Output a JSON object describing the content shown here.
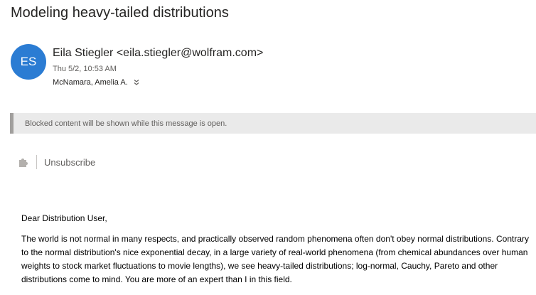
{
  "message": {
    "subject": "Modeling heavy-tailed distributions",
    "avatar_initials": "ES",
    "sender": "Eila Stiegler <eila.stiegler@wolfram.com>",
    "date": "Thu 5/2, 10:53 AM",
    "recipients": "McNamara, Amelia A."
  },
  "banner": {
    "text": "Blocked content will be shown while this message is open."
  },
  "actions": {
    "unsubscribe_label": "Unsubscribe"
  },
  "body": {
    "greeting": "Dear Distribution User,",
    "paragraph1": "The world is not normal in many respects, and practically observed random phenomena often don't obey normal distributions. Contrary to the normal distribution's nice exponential decay, in a large variety of real-world phenomena (from chemical abundances over human weights to stock market fluctuations to movie lengths), we see heavy-tailed distributions; log-normal, Cauchy, Pareto and other distributions come to mind. You are more of an expert than I in this field."
  },
  "colors": {
    "avatar_bg": "#2b7cd3",
    "banner_bg": "#eaeaea",
    "banner_border": "#a19f9d"
  },
  "icons": {
    "expand": "chevron-double-down-icon",
    "add_in": "puzzle-piece-icon"
  }
}
